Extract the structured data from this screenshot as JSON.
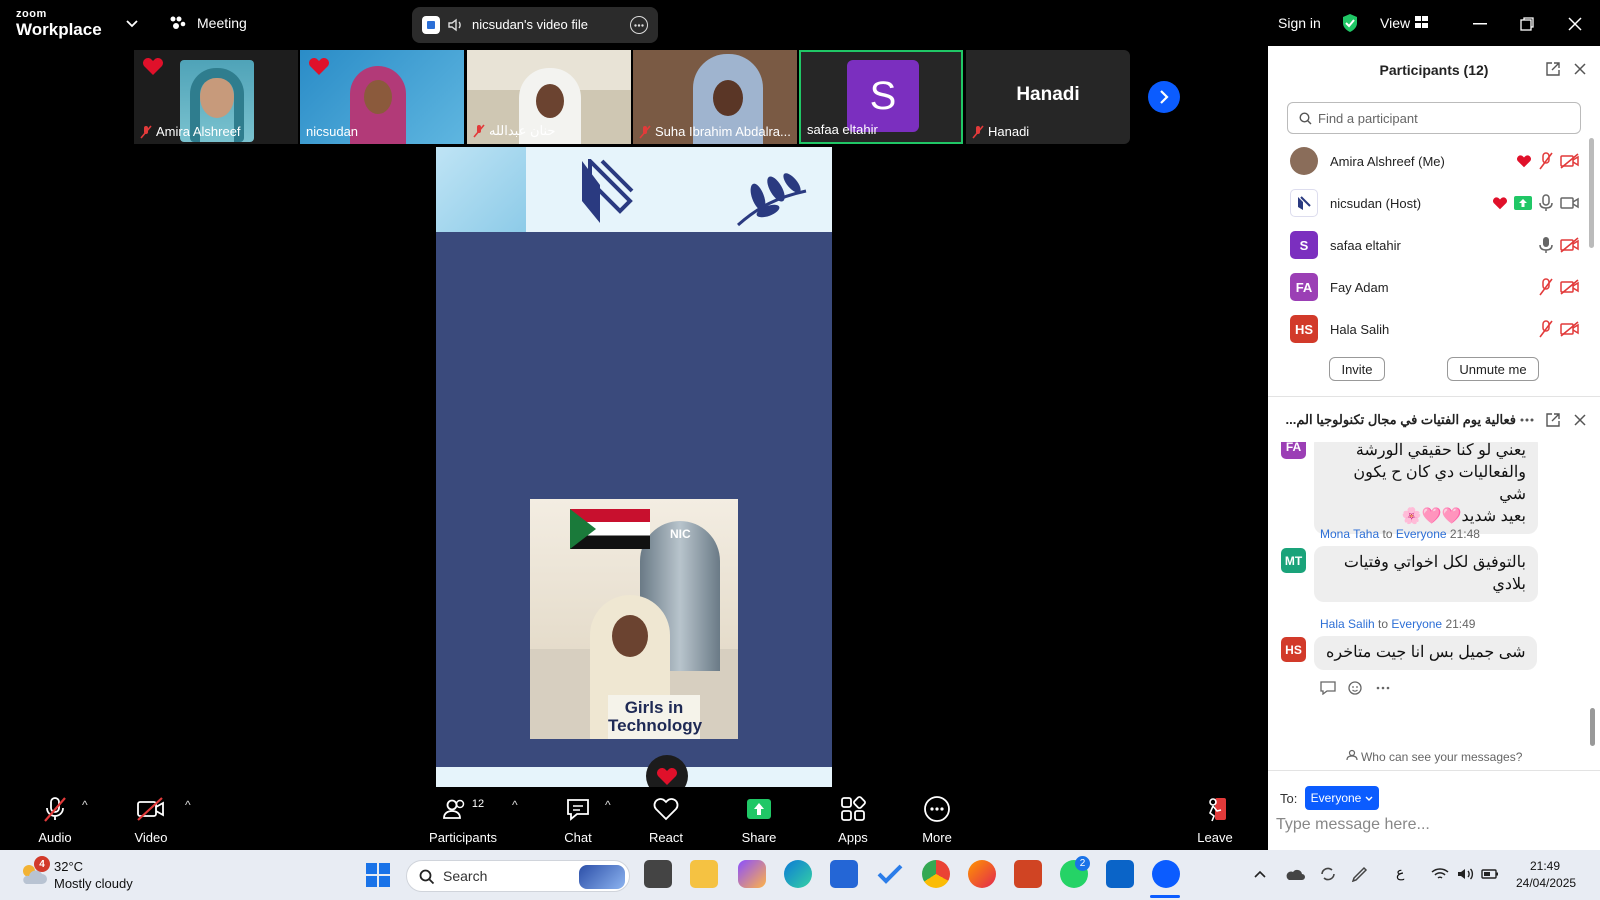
{
  "topbar": {
    "brand_small": "zoom",
    "brand_large": "Workplace",
    "meeting_label": "Meeting",
    "file_label": "nicsudan's video file",
    "sign_in": "Sign in",
    "view_label": "View"
  },
  "videos": [
    {
      "name": "Amira Alshreef",
      "muted": true,
      "heart": true
    },
    {
      "name": "nicsudan",
      "muted": false,
      "heart": true
    },
    {
      "name": "حنان عبدالله",
      "muted": true,
      "heart": false
    },
    {
      "name": "Suha Ibrahim Abdalra...",
      "muted": true,
      "heart": false
    },
    {
      "name": "safaa eltahir",
      "muted": false,
      "heart": false,
      "initial": "S"
    },
    {
      "name": "Hanadi",
      "muted": true,
      "heart": false,
      "center_label": "Hanadi"
    }
  ],
  "share": {
    "poster_caption_1": "Girls in",
    "poster_caption_2": "Technology",
    "logo_text": "NIC"
  },
  "toolbar": {
    "audio": "Audio",
    "video": "Video",
    "participants": "Participants",
    "participants_count": "12",
    "chat": "Chat",
    "react": "React",
    "share": "Share",
    "apps": "Apps",
    "more": "More",
    "leave": "Leave"
  },
  "participants_panel": {
    "title": "Participants (12)",
    "search_placeholder": "Find a participant",
    "rows": [
      {
        "name": "Amira Alshreef (Me)",
        "avatar": "",
        "avatar_color": "#8a6d5a"
      },
      {
        "name": "nicsudan (Host)",
        "avatar": "",
        "avatar_color": "#ffffff"
      },
      {
        "name": "safaa eltahir",
        "avatar": "S",
        "avatar_color": "#7b2fbf"
      },
      {
        "name": "Fay Adam",
        "avatar": "FA",
        "avatar_color": "#9b3fb5"
      },
      {
        "name": "Hala Salih",
        "avatar": "HS",
        "avatar_color": "#d23a2a"
      }
    ],
    "invite": "Invite",
    "unmute": "Unmute me"
  },
  "chat_panel": {
    "title": "فعالية يوم الفتيات في مجال تكنولوجيا الم...",
    "messages": [
      {
        "avatar": "FA",
        "avatar_color": "#9b3fb5",
        "sender": "",
        "to": "",
        "time": "",
        "lines": [
          "يعني لو كنا حقيقي الورشة",
          "والفعاليات دي كان ح يكون شي",
          "بعيد شديد🩷🩷🌸"
        ]
      },
      {
        "avatar": "MT",
        "avatar_color": "#1aa37a",
        "sender": "Mona Taha",
        "to": "Everyone",
        "time": "21:48",
        "lines": [
          "بالتوفيق لكل اخواتي وفتيات",
          "بلادي"
        ]
      },
      {
        "avatar": "HS",
        "avatar_color": "#d23a2a",
        "sender": "Hala Salih",
        "to": "Everyone",
        "time": "21:49",
        "lines": [
          "شى جميل بس انا جيت متاخره"
        ]
      }
    ],
    "to_word": "to",
    "visibility": "Who can see your messages?",
    "to_label": "To:",
    "recipient": "Everyone",
    "input_placeholder": "Type message here..."
  },
  "taskbar": {
    "temp": "32°C",
    "weather": "Mostly cloudy",
    "weather_badge": "4",
    "search": "Search",
    "whatsapp_badge": "2",
    "lang": "ع",
    "time": "21:49",
    "date": "24/04/2025"
  },
  "colors": {
    "accent_green": "#20c766",
    "zoom_blue": "#0b5cff",
    "heart_red": "#e0102a",
    "share_bg": "#3a4a7c"
  }
}
